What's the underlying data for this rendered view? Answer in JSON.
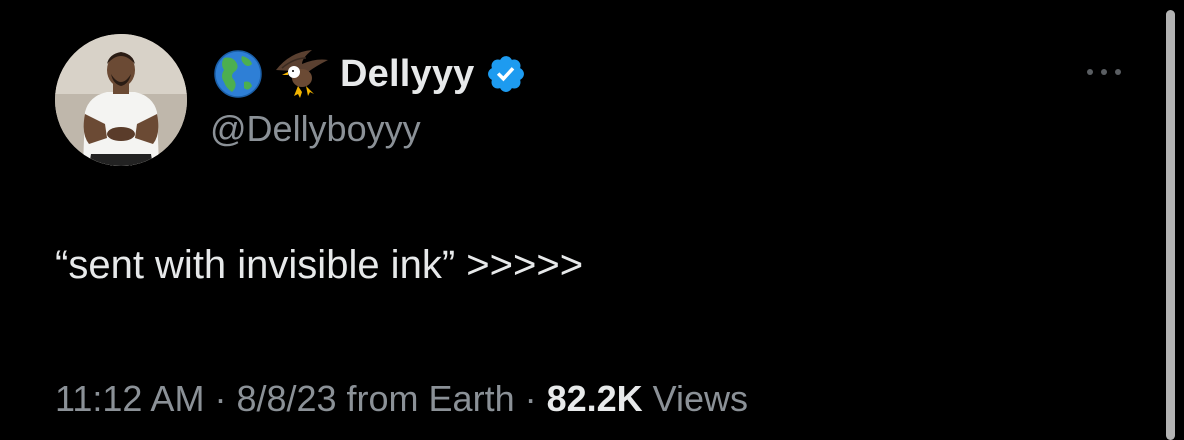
{
  "author": {
    "display_name": "Dellyyy",
    "handle": "@Dellyboyyy",
    "emoji_icons": [
      "globe-americas-icon",
      "eagle-icon"
    ],
    "verified": true
  },
  "tweet": {
    "text": "“sent with invisible ink” >>>>>"
  },
  "meta": {
    "time": "11:12 AM",
    "separator": " · ",
    "date": "8/8/23",
    "source_prefix": " from ",
    "source": "Earth",
    "views_count": "82.2K",
    "views_label": " Views"
  },
  "colors": {
    "background": "#000000",
    "primary_text": "#e7e9ea",
    "secondary_text": "#8b9197",
    "verified_blue": "#1d9bf0"
  }
}
